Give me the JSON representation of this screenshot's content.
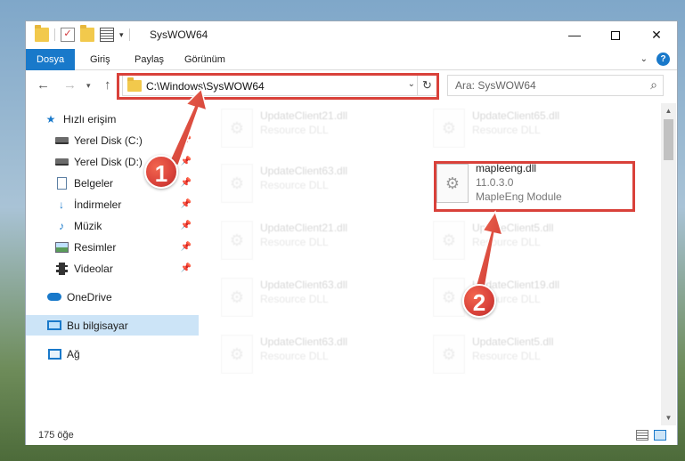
{
  "window": {
    "title": "SysWOW64",
    "minimize": "—",
    "close": "✕"
  },
  "ribbon": {
    "tabs": [
      {
        "label": "Dosya"
      },
      {
        "label": "Giriş"
      },
      {
        "label": "Paylaş"
      },
      {
        "label": "Görünüm"
      }
    ],
    "help": "?"
  },
  "nav": {
    "address": "C:\\Windows\\SysWOW64",
    "search_placeholder": "Ara: SysWOW64"
  },
  "sidebar": {
    "items": [
      {
        "label": "Hızlı erişim"
      },
      {
        "label": "Yerel Disk (C:)"
      },
      {
        "label": "Yerel Disk (D:)"
      },
      {
        "label": "Belgeler"
      },
      {
        "label": "İndirmeler"
      },
      {
        "label": "Müzik"
      },
      {
        "label": "Resimler"
      },
      {
        "label": "Videolar"
      },
      {
        "label": "OneDrive"
      },
      {
        "label": "Bu bilgisayar"
      },
      {
        "label": "Ağ"
      }
    ]
  },
  "files": [
    {
      "name": "UpdateClient21.dll",
      "sub": "Resource DLL"
    },
    {
      "name": "UpdateClient65.dll",
      "sub": "Resource DLL"
    },
    {
      "name": "UpdateClient63.dll",
      "sub": "Resource DLL"
    },
    {
      "name": "mapleeng.dll",
      "version": "11.0.3.0",
      "desc": "MapleEng Module"
    },
    {
      "name": "UpdateClient21.dll",
      "sub": "Resource DLL"
    },
    {
      "name": "UpdateClient5.dll",
      "sub": "Resource DLL"
    },
    {
      "name": "UpdateClient63.dll",
      "sub": "Resource DLL"
    },
    {
      "name": "UpdateClient19.dll",
      "sub": "Resource DLL"
    },
    {
      "name": "UpdateClient63.dll",
      "sub": "Resource DLL"
    },
    {
      "name": "UpdateClient5.dll",
      "sub": "Resource DLL"
    }
  ],
  "status": {
    "count": "175 öğe"
  },
  "annotations": {
    "badge1": "1",
    "badge2": "2",
    "highlight_color": "#d9413a"
  }
}
